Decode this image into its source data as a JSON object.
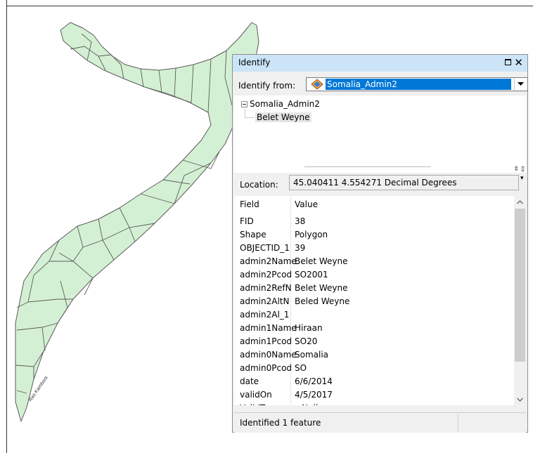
{
  "map": {
    "fill_color": "#d4f0d4",
    "line_color": "#5a5a5a",
    "labels": [
      "Ras Kamboni"
    ]
  },
  "identify": {
    "title": "Identify",
    "close_symbol": "✕",
    "identify_from_label": "Identify from:",
    "layer_selected": "Somalia_Admin2",
    "tree": {
      "layer": "Somalia_Admin2",
      "feature": "Belet Weyne"
    },
    "splitter_buttons": "⇳ ▯",
    "location_label": "Location:",
    "location_value": "45.040411  4.554271 Decimal Degrees",
    "table": {
      "header": {
        "field": "Field",
        "value": "Value"
      },
      "rows": [
        {
          "field": "FID",
          "value": "38"
        },
        {
          "field": "Shape",
          "value": "Polygon"
        },
        {
          "field": "OBJECTID_1",
          "value": "39"
        },
        {
          "field": "admin2Name",
          "value": "Belet Weyne"
        },
        {
          "field": "admin2Pcod",
          "value": "SO2001"
        },
        {
          "field": "admin2RefN",
          "value": "Belet Weyne"
        },
        {
          "field": "admin2AltN",
          "value": "Beled Weyne"
        },
        {
          "field": "admin2Al_1",
          "value": ""
        },
        {
          "field": "admin1Name",
          "value": "Hiraan"
        },
        {
          "field": "admin1Pcod",
          "value": "SO20"
        },
        {
          "field": "admin0Name",
          "value": "Somalia"
        },
        {
          "field": "admin0Pcod",
          "value": "SO"
        },
        {
          "field": "date",
          "value": "6/6/2014"
        },
        {
          "field": "validOn",
          "value": "4/5/2017"
        },
        {
          "field": "ValidTo",
          "value": "<Null>"
        }
      ]
    },
    "status": "Identified 1 feature",
    "colors": {
      "title_bar": "#cce4f7",
      "selection": "#0078d7"
    }
  }
}
